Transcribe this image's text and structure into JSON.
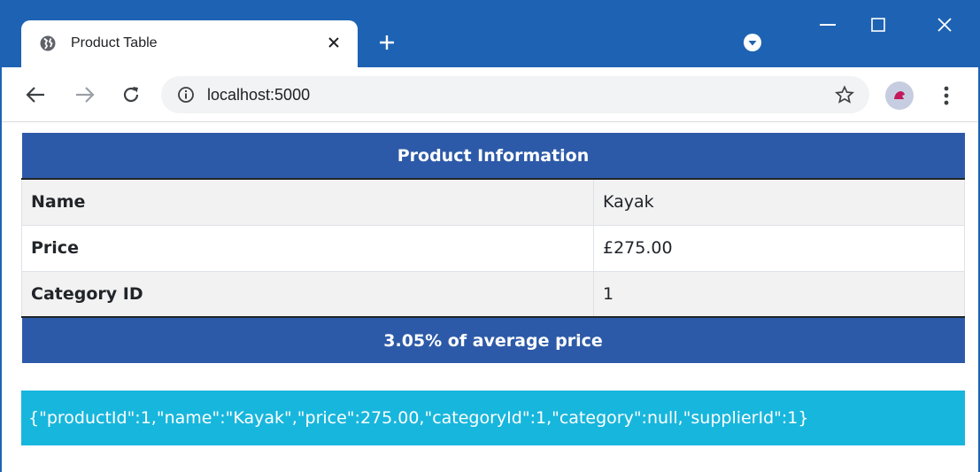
{
  "browser": {
    "tab_title": "Product Table",
    "url": "localhost:5000",
    "colors": {
      "frame": "#1e63b3",
      "omnibox": "#f1f3f4"
    },
    "icons": [
      "globe-icon",
      "close-icon",
      "plus-icon",
      "profile-dropdown-icon",
      "minimize-icon",
      "maximize-icon",
      "window-close-icon",
      "back-arrow-icon",
      "forward-arrow-icon",
      "reload-icon",
      "info-icon",
      "star-icon",
      "avatar-icon",
      "kebab-menu-icon"
    ]
  },
  "page": {
    "table": {
      "header": "Product Information",
      "rows": [
        {
          "label": "Name",
          "value": "Kayak"
        },
        {
          "label": "Price",
          "value": "£275.00"
        },
        {
          "label": "Category ID",
          "value": "1"
        }
      ],
      "footer": "3.05% of average price"
    },
    "json_text": "{\"productId\":1,\"name\":\"Kayak\",\"price\":275.00,\"categoryId\":1,\"category\":null,\"supplierId\":1}",
    "colors": {
      "table_header": "#2d5aa8",
      "json_box": "#17b6dd"
    }
  }
}
